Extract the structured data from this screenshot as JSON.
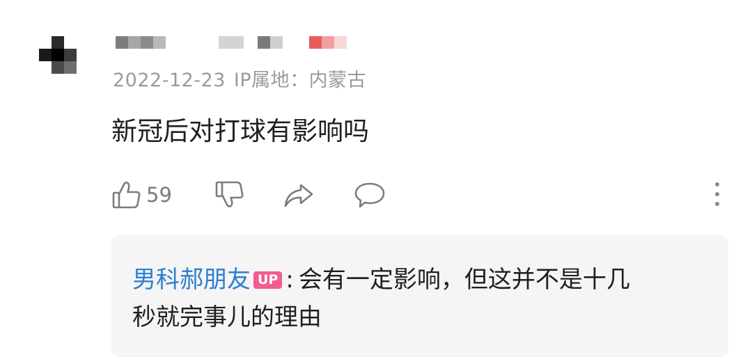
{
  "comment": {
    "avatar_icon": "pixelated-avatar-icon",
    "username": "",
    "date": "2022-12-23",
    "ip_location": "IP属地：内蒙古",
    "content": "新冠后对打球有影响吗",
    "like_count": "59"
  },
  "actions": {
    "like_icon": "thumbs-up-icon",
    "dislike_icon": "thumbs-down-icon",
    "share_icon": "share-arrow-icon",
    "reply_icon": "speech-bubble-icon",
    "more_icon": "vertical-ellipsis-icon"
  },
  "reply": {
    "author": "男科郝朋友",
    "badge": "UP",
    "separator": ":",
    "text_line1": "会有一定影响，但这并不是十几",
    "text_line2": "秒就完事儿的理由"
  },
  "colors": {
    "link_blue": "#2b7fd4",
    "up_badge_pink": "#f25d8e",
    "meta_gray": "#9a9a9a",
    "reply_background": "#f5f5f5"
  }
}
